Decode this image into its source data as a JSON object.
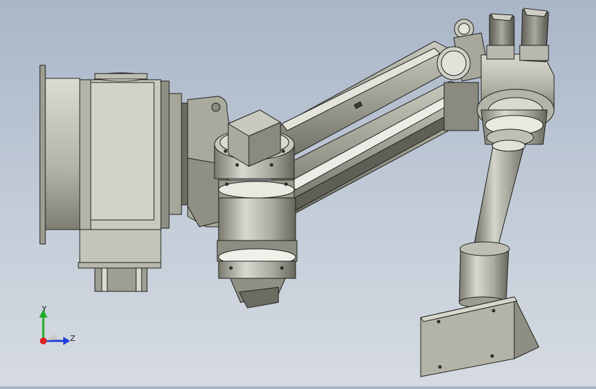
{
  "colors": {
    "background_top": "#a9b6c8",
    "background_bottom": "#d6dbe2",
    "metal_light": "#d7d7cf",
    "metal_mid": "#a8a89c",
    "metal_dark": "#6f6f66",
    "outline": "#1f1f1c",
    "axis_x": "#e01f1f",
    "axis_y": "#1fae2a",
    "axis_z": "#1f3fd6"
  },
  "triad": {
    "y_label": "Y",
    "z_label": "Z"
  },
  "model": {
    "parts": [
      "base-housing",
      "shoulder-bracket",
      "shoulder-joint",
      "upper-arm",
      "elbow-joint",
      "servo-motors",
      "forearm",
      "wrist-joint",
      "end-effector-plate"
    ]
  }
}
